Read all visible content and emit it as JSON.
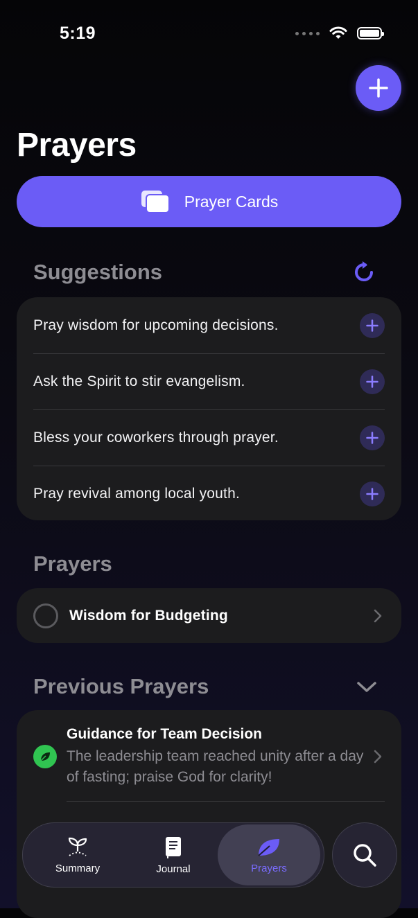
{
  "status": {
    "time": "5:19"
  },
  "header": {
    "title": "Prayers"
  },
  "prayer_cards_button": {
    "label": "Prayer Cards"
  },
  "suggestions": {
    "title": "Suggestions",
    "items": [
      {
        "text": "Pray wisdom for upcoming decisions."
      },
      {
        "text": "Ask the Spirit to stir evangelism."
      },
      {
        "text": "Bless your coworkers through prayer."
      },
      {
        "text": "Pray revival among local youth."
      }
    ]
  },
  "prayers": {
    "title": "Prayers",
    "items": [
      {
        "title": "Wisdom for Budgeting"
      }
    ]
  },
  "previous_prayers": {
    "title": "Previous Prayers",
    "items": [
      {
        "title": "Guidance for Team Decision",
        "body": "The leadership team reached unity after a day of fasting; praise God for clarity!"
      }
    ]
  },
  "tabbar": {
    "tabs": [
      {
        "label": "Summary",
        "icon": "sprout-icon"
      },
      {
        "label": "Journal",
        "icon": "journal-icon"
      },
      {
        "label": "Prayers",
        "icon": "leaf-icon",
        "active": true
      }
    ]
  },
  "colors": {
    "accent": "#6b5cf6",
    "card": "#1c1c1e",
    "muted": "#8e8d93",
    "answered": "#30c451"
  }
}
